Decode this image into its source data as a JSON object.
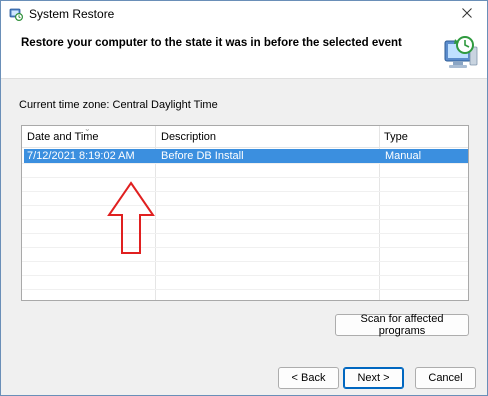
{
  "window": {
    "title": "System Restore",
    "icon": "system-restore-icon"
  },
  "header": {
    "heading": "Restore your computer to the state it was in before the selected event",
    "art_icon": "restore-computer-icon"
  },
  "timezone": {
    "label": "Current time zone: Central Daylight Time"
  },
  "table": {
    "columns": [
      "Date and Time",
      "Description",
      "Type"
    ],
    "sorted_by": "Date and Time",
    "rows": [
      {
        "date": "7/12/2021 8:19:02 AM",
        "description": "Before DB Install",
        "type": "Manual",
        "selected": true
      }
    ]
  },
  "annotation": {
    "icon": "red-up-arrow-icon",
    "color": "#e02020"
  },
  "buttons": {
    "scan": "Scan for affected programs",
    "back": "< Back",
    "next": "Next >",
    "cancel": "Cancel"
  },
  "colors": {
    "selection": "#3b8fdf",
    "default_button_border": "#0067c0",
    "window_border": "#6a8fb8"
  }
}
